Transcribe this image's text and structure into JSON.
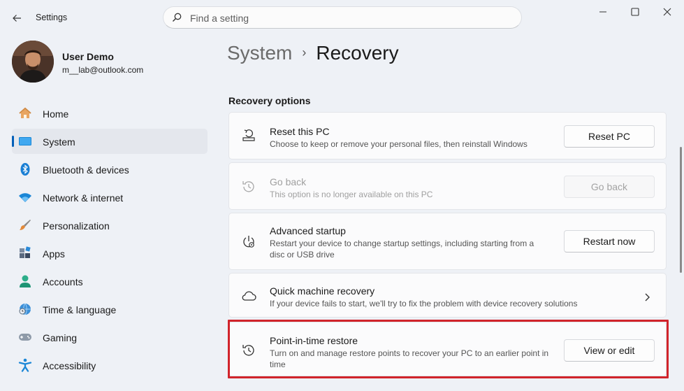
{
  "window": {
    "app_title": "Settings",
    "search_placeholder": "Find a setting"
  },
  "profile": {
    "name": "User Demo",
    "email": "m__lab@outlook.com"
  },
  "sidebar": {
    "items": [
      {
        "label": "Home",
        "icon": "home-icon",
        "active": false
      },
      {
        "label": "System",
        "icon": "system-icon",
        "active": true
      },
      {
        "label": "Bluetooth & devices",
        "icon": "bluetooth-icon",
        "active": false
      },
      {
        "label": "Network & internet",
        "icon": "wifi-icon",
        "active": false
      },
      {
        "label": "Personalization",
        "icon": "brush-icon",
        "active": false
      },
      {
        "label": "Apps",
        "icon": "apps-icon",
        "active": false
      },
      {
        "label": "Accounts",
        "icon": "accounts-icon",
        "active": false
      },
      {
        "label": "Time & language",
        "icon": "globe-clock-icon",
        "active": false
      },
      {
        "label": "Gaming",
        "icon": "gamepad-icon",
        "active": false
      },
      {
        "label": "Accessibility",
        "icon": "accessibility-icon",
        "active": false
      }
    ]
  },
  "breadcrumb": {
    "parent": "System",
    "separator": "›",
    "current": "Recovery"
  },
  "recovery": {
    "section_title": "Recovery options",
    "cards": [
      {
        "title": "Reset this PC",
        "description": "Choose to keep or remove your personal files, then reinstall Windows",
        "button": "Reset PC",
        "icon": "reset-pc-icon",
        "enabled": true
      },
      {
        "title": "Go back",
        "description": "This option is no longer available on this PC",
        "button": "Go back",
        "icon": "history-icon",
        "enabled": false
      },
      {
        "title": "Advanced startup",
        "description": "Restart your device to change startup settings, including starting from a disc or USB drive",
        "button": "Restart now",
        "icon": "advanced-startup-icon",
        "enabled": true
      },
      {
        "title": "Quick machine recovery",
        "description": "If your device fails to start, we'll try to fix the problem with device recovery solutions",
        "icon": "cloud-icon",
        "enabled": true
      },
      {
        "title": "Point-in-time restore",
        "description": "Turn on and manage restore points to recover your PC to an earlier point in time",
        "button": "View or edit",
        "icon": "restore-icon",
        "enabled": true
      }
    ]
  },
  "colors": {
    "accent": "#005fb8",
    "highlight": "#d1242b",
    "background": "#eef1f6"
  }
}
